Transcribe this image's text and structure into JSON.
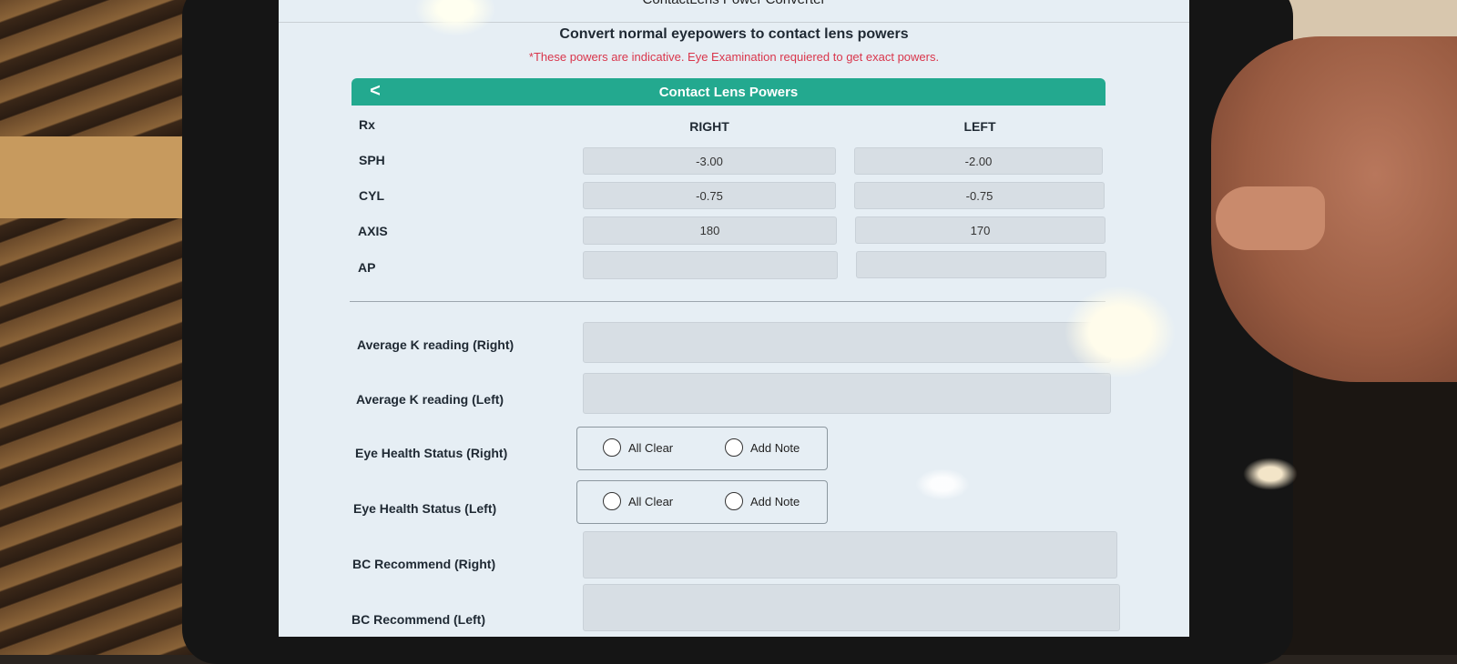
{
  "app": {
    "title": "ContactLens Power Converter",
    "headline": "Convert normal eyepowers to contact lens powers",
    "disclaimer": "*These powers are indicative. Eye Examination requiered to get exact powers."
  },
  "card": {
    "back_icon": "chevron-left-icon",
    "back_glyph": "<",
    "title": "Contact Lens Powers"
  },
  "rx": {
    "label": "Rx",
    "right_header": "RIGHT",
    "left_header": "LEFT",
    "rows": [
      {
        "label": "SPH",
        "right": "-3.00",
        "left": "-2.00"
      },
      {
        "label": "CYL",
        "right": "-0.75",
        "left": "-0.75"
      },
      {
        "label": "AXIS",
        "right": "180",
        "left": "170"
      },
      {
        "label": "AP",
        "right": "",
        "left": ""
      }
    ]
  },
  "fields": {
    "k_right": {
      "label": "Average K reading (Right)",
      "value": ""
    },
    "k_left": {
      "label": "Average K reading (Left)",
      "value": ""
    },
    "health_right": {
      "label": "Eye Health Status (Right)",
      "opt1": "All Clear",
      "opt2": "Add Note"
    },
    "health_left": {
      "label": "Eye Health Status (Left)",
      "opt1": "All Clear",
      "opt2": "Add Note"
    },
    "bc_right": {
      "label": "BC Recommend (Right)",
      "value": ""
    },
    "bc_left": {
      "label": "BC Recommend (Left)",
      "value": ""
    }
  },
  "colors": {
    "accent": "#23a98f",
    "warning": "#d9364c"
  }
}
